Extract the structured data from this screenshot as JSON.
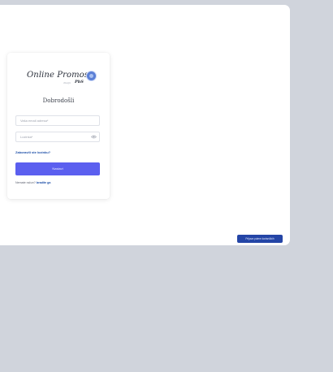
{
  "logo": {
    "brand_text": "Online Promos",
    "by_text": "dizajn",
    "sub_brand": "PbS"
  },
  "login": {
    "welcome": "Dobrodošli",
    "email_placeholder": "Vaša email adresa*",
    "password_placeholder": "Lozinka*",
    "forgot_password": "Zaboravili ste lozinku?",
    "submit_label": "Nastavi",
    "register_prompt": "Nemate račun?",
    "register_link": "Izradite ga"
  },
  "corner_button": {
    "label": "Prijava putem korisničkih"
  },
  "colors": {
    "page_background": "#d0d4dc",
    "primary_button": "#5b5fef",
    "link": "#1d4fa8",
    "corner_button": "#2445a6"
  },
  "icons": {
    "logo_badge": "globe-badge-icon",
    "password_toggle": "eye-icon"
  }
}
